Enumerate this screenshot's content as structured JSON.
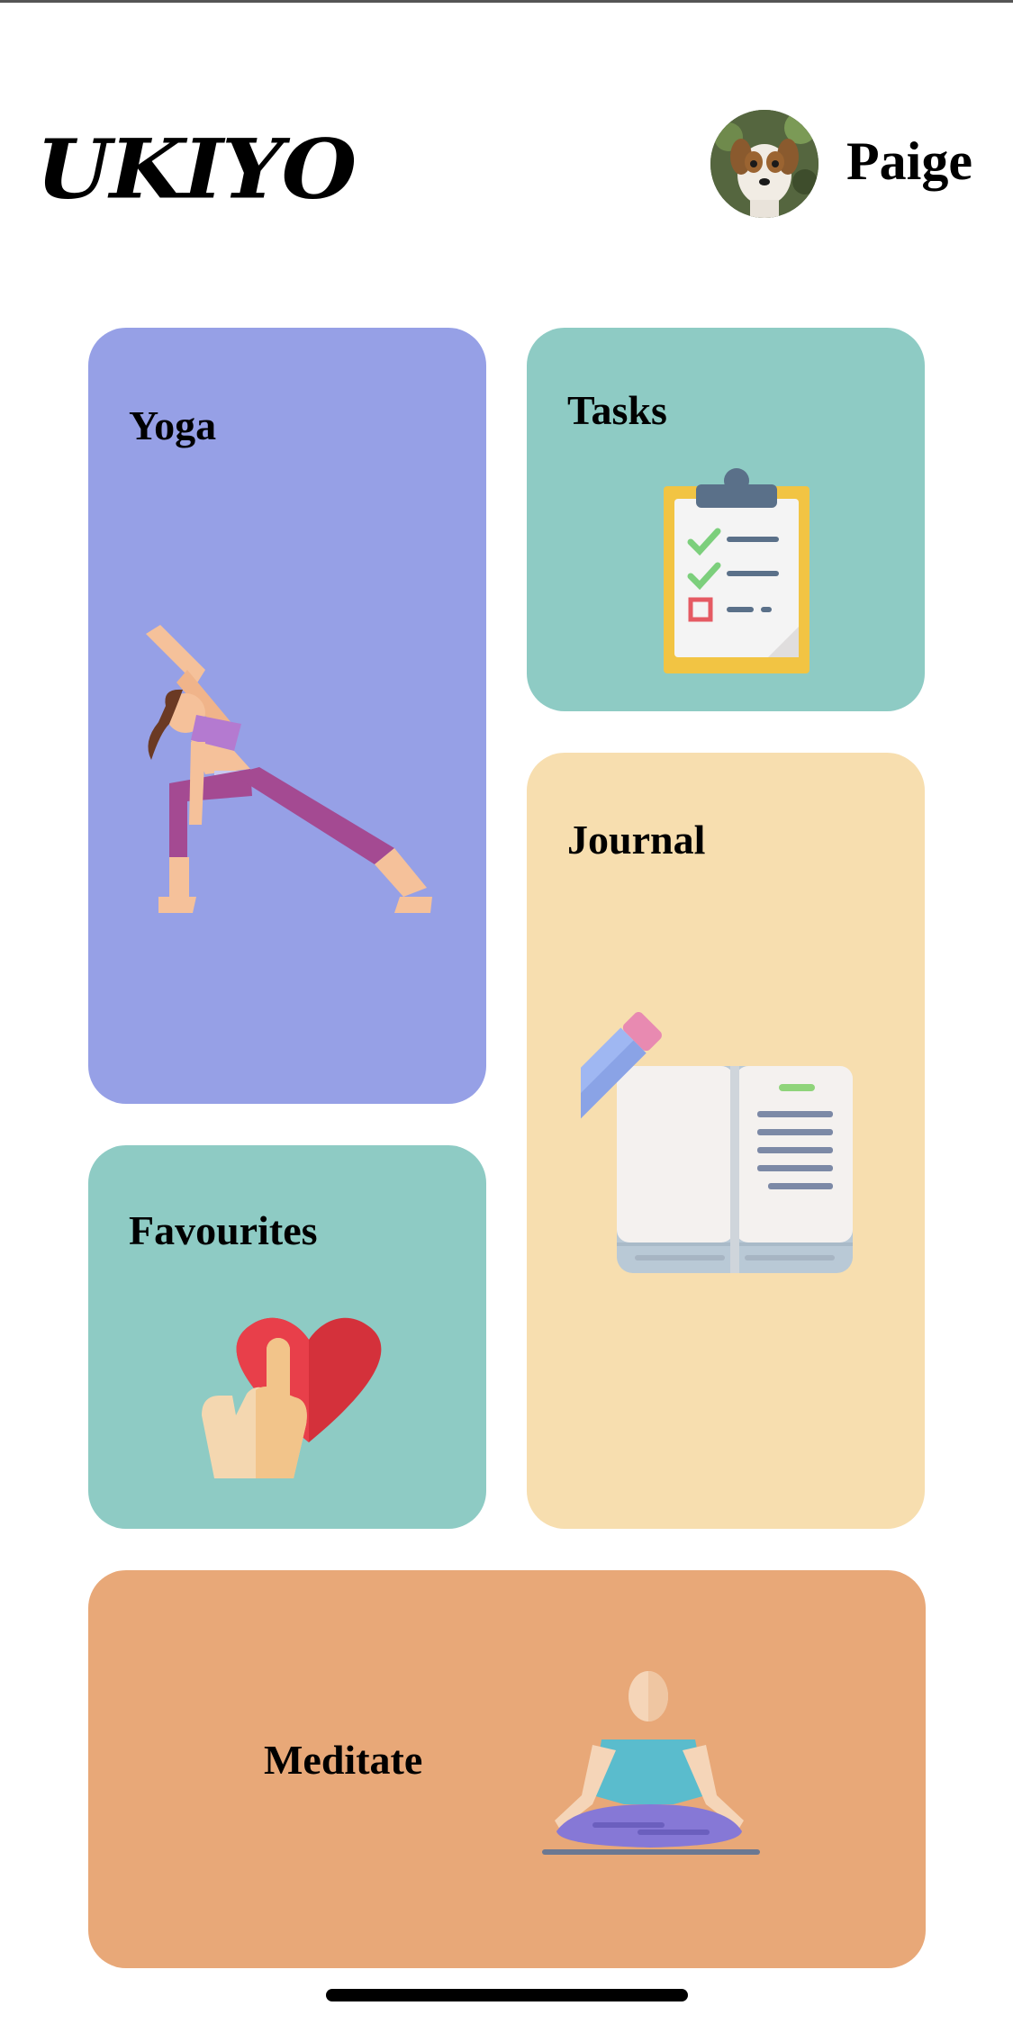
{
  "app": {
    "logo": "UKIYO"
  },
  "user": {
    "name": "Paige",
    "avatar_icon": "dog-avatar"
  },
  "cards": {
    "yoga": {
      "label": "Yoga",
      "color": "#96a0e6",
      "icon": "yoga-pose-icon"
    },
    "tasks": {
      "label": "Tasks",
      "color": "#8ecbc4",
      "icon": "clipboard-checklist-icon"
    },
    "journal": {
      "label": "Journal",
      "color": "#f7deaf",
      "icon": "open-book-pencil-icon"
    },
    "favourites": {
      "label": "Favourites",
      "color": "#8ecbc4",
      "icon": "heart-hand-icon"
    },
    "meditate": {
      "label": "Meditate",
      "color": "#e8a878",
      "icon": "meditation-icon"
    }
  }
}
